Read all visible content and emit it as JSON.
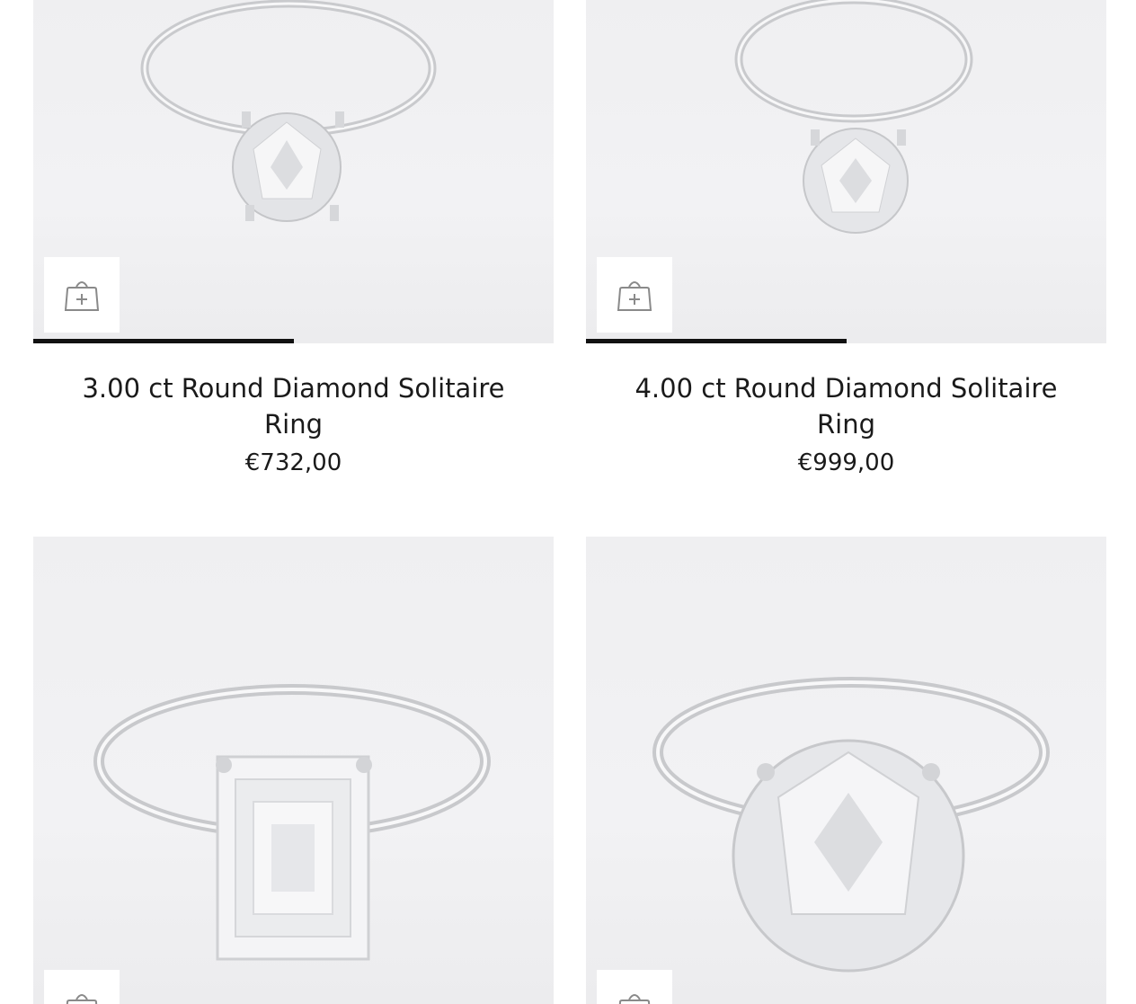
{
  "products": [
    {
      "title": "3.00 ct Round Diamond Solitaire Ring",
      "price": "€732,00",
      "cart_icon": "shopping-bag-plus-icon"
    },
    {
      "title": "4.00 ct Round Diamond Solitaire Ring",
      "price": "€999,00",
      "cart_icon": "shopping-bag-plus-icon"
    },
    {
      "title": "",
      "price": "",
      "cart_icon": "shopping-bag-plus-icon"
    },
    {
      "title": "",
      "price": "",
      "cart_icon": "shopping-bag-plus-icon"
    }
  ],
  "colors": {
    "image_bg": "#efeff1",
    "progress": "#111111",
    "text": "#1a1a1a"
  }
}
